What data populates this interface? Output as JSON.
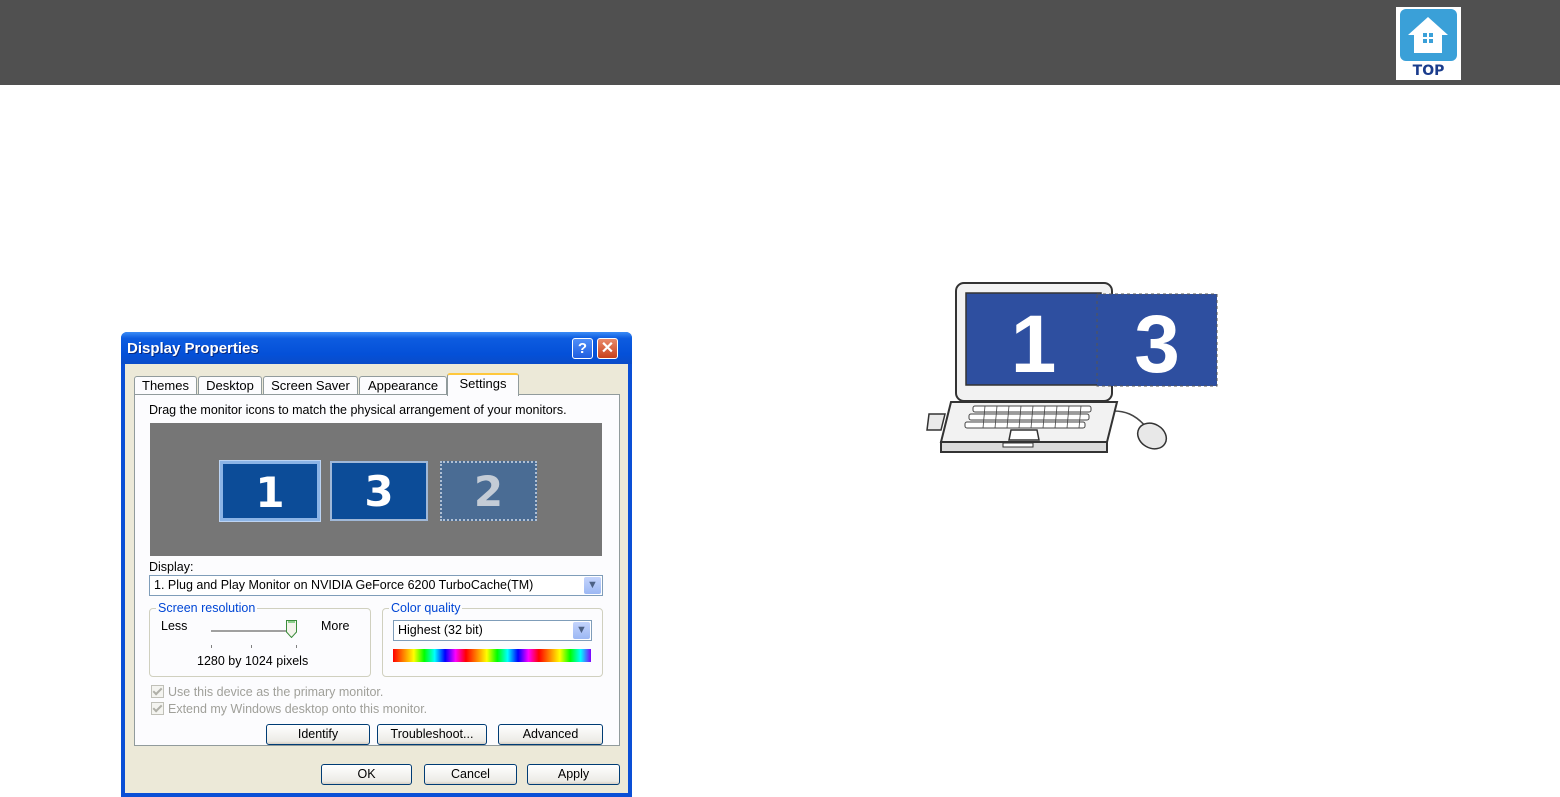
{
  "header": {
    "top_label": "TOP",
    "top_icon": "home-house-icon",
    "background_color": "#505050"
  },
  "dialog": {
    "title": "Display Properties",
    "help_label": "?",
    "close_label": "✕",
    "tabs": [
      {
        "label": "Themes"
      },
      {
        "label": "Desktop"
      },
      {
        "label": "Screen Saver"
      },
      {
        "label": "Appearance"
      },
      {
        "label": "Settings"
      }
    ],
    "active_tab": "Settings",
    "instruction": "Drag the monitor icons to match the physical arrangement of your monitors.",
    "monitors": [
      {
        "number": "1",
        "state": "selected"
      },
      {
        "number": "3",
        "state": "attached"
      },
      {
        "number": "2",
        "state": "inactive"
      }
    ],
    "display_label": "Display:",
    "display_value": "1. Plug and Play Monitor on NVIDIA GeForce 6200 TurboCache(TM)",
    "screen_resolution": {
      "title": "Screen resolution",
      "less": "Less",
      "more": "More",
      "value_text": "1280 by 1024 pixels",
      "slider_level": 1.0
    },
    "color_quality": {
      "title": "Color quality",
      "value": "Highest (32 bit)"
    },
    "checkboxes": [
      {
        "label": "Use this device as the primary monitor.",
        "checked": true,
        "enabled": false
      },
      {
        "label": "Extend my Windows desktop onto this monitor.",
        "checked": true,
        "enabled": false
      }
    ],
    "buttons": {
      "identify": "Identify",
      "troubleshoot": "Troubleshoot...",
      "advanced": "Advanced",
      "ok": "OK",
      "cancel": "Cancel",
      "apply": "Apply"
    }
  },
  "illustration": {
    "laptop_screen_number": "1",
    "second_screen_number": "3",
    "screen_color": "#2e4fa0"
  }
}
